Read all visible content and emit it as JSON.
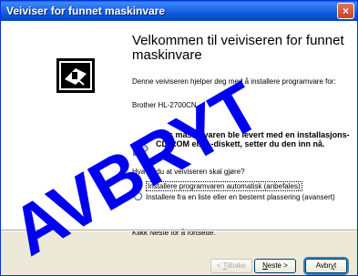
{
  "window": {
    "title": "Veiviser for funnet maskinvare",
    "close_glyph": "×"
  },
  "content": {
    "heading": "Velkommen til veiviseren for funnet maskinvare",
    "intro": "Denne veiviseren hjelper deg med å installere programvare for:",
    "model": "Brother HL-2700CN",
    "cd_text": "Hvis maskinvaren ble levert med en installasjons-CD-ROM eller -diskett, setter du den inn nå.",
    "question": "Hva vil du at veiviseren skal gjøre?",
    "options": [
      {
        "label": "Installere programvaren automatisk (anbefales)",
        "selected": true
      },
      {
        "label": "Installere fra en liste eller en bestemt plassering (avansert)",
        "selected": false
      }
    ],
    "footer": "Klikk Neste for å fortsette."
  },
  "buttons": {
    "back_prefix": "< ",
    "back_key": "T",
    "back_rest": "ilbake",
    "next_key": "N",
    "next_rest": "este >",
    "cancel_pre": "Avbr",
    "cancel_key": "y",
    "cancel_post": "t"
  },
  "stamp": {
    "text": "AVBRYT",
    "color": "#0000f0"
  },
  "icons": {
    "hardware": "hardware-wizard-icon",
    "cd": "cd-disk-icon"
  }
}
